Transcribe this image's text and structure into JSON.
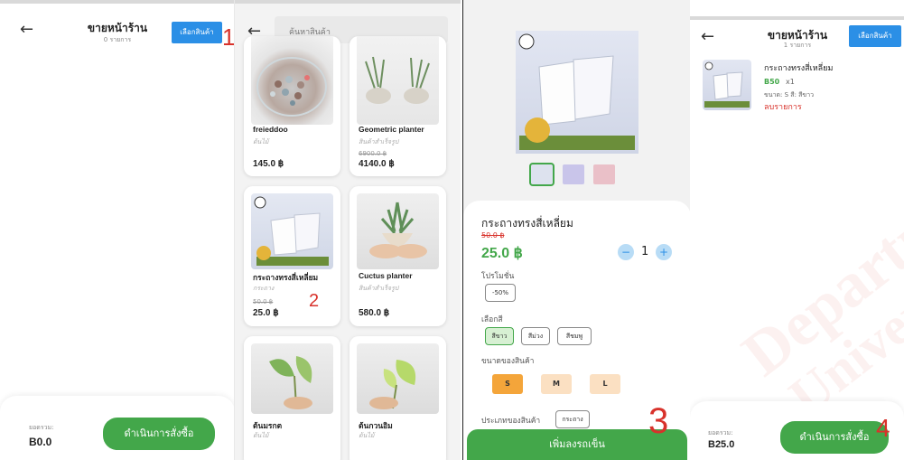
{
  "panel1": {
    "title": "ขายหน้าร้าน",
    "subtitle": "0 รายการ",
    "select_button": "เลือกสินค้า",
    "marker": "1",
    "total_label": "ยอดรวม:",
    "total_value": "B0.0",
    "checkout_button": "ดำเนินการสั่งซื้อ"
  },
  "panel2": {
    "search_placeholder": "ค้นหาสินค้า",
    "marker": "2",
    "products": [
      {
        "name": "freieddoo",
        "category": "ต้นไม้",
        "old_price": "",
        "price": "145.0 ฿"
      },
      {
        "name": "Geometric planter",
        "category": "สินค้าสำเร็จรูป",
        "old_price": "6900.0 ฿",
        "price": "4140.0 ฿"
      },
      {
        "name": "กระถางทรงสี่เหลี่ยม",
        "category": "กระถาง",
        "old_price": "50.0 ฿",
        "price": "25.0 ฿"
      },
      {
        "name": "Cuctus planter",
        "category": "สินค้าสำเร็จรูป",
        "old_price": "",
        "price": "580.0 ฿"
      },
      {
        "name": "ต้นมรกต",
        "category": "ต้นไม้",
        "old_price": "",
        "price": ""
      },
      {
        "name": "ต้นกวนอิม",
        "category": "ต้นไม้",
        "old_price": "",
        "price": ""
      }
    ]
  },
  "panel3": {
    "product_name": "กระถางทรงสี่เหลี่ยม",
    "old_price": "50.0 ฿",
    "price": "25.0 ฿",
    "quantity": "1",
    "minus": "−",
    "plus": "+",
    "promotion_label": "โปรโมชั่น",
    "promotion_value": "-50%",
    "color_label": "เลือกสี",
    "colors": [
      "สีขาว",
      "สีม่วง",
      "สีชมพู"
    ],
    "size_label": "ขนาดของสินค้า",
    "sizes": [
      "S",
      "M",
      "L"
    ],
    "type_label": "ประเภทของสินค้า",
    "type_value": "กระถาง",
    "add_to_cart": "เพิ่มลงรถเข็น",
    "marker": "3"
  },
  "panel4": {
    "title": "ขายหน้าร้าน",
    "subtitle": "1 รายการ",
    "select_button": "เลือกสินค้า",
    "item_name": "กระถางทรงสี่เหลี่ยม",
    "item_price": "B50",
    "item_qty": "x1",
    "item_detail": "ขนาด: S  สี: สีขาว",
    "remove_link": "ลบรายการ",
    "total_label": "ยอดรวม:",
    "total_value": "B25.0",
    "checkout_button": "ดำเนินการสั่งซื้อ",
    "marker": "4"
  },
  "watermark": {
    "line1": "Department",
    "line2": "University"
  },
  "colors": {
    "blue": "#2b8fe6",
    "green": "#43a74a",
    "red": "#d8322b",
    "orange": "#f4a53a",
    "peach": "#fbe0c2"
  }
}
